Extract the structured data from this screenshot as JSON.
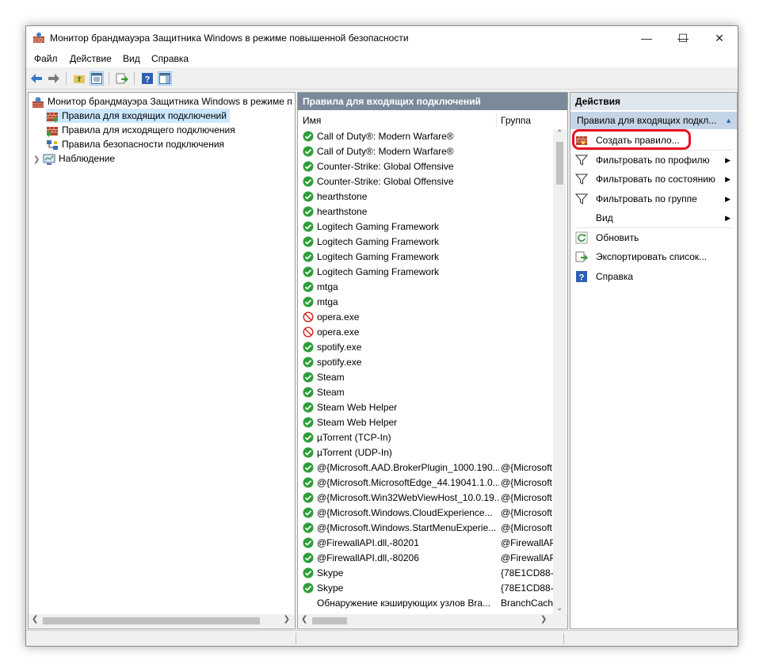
{
  "window": {
    "title": "Монитор брандмауэра Защитника Windows в режиме повышенной безопасности",
    "minimize": "—",
    "maximize": "☐",
    "close": "✕"
  },
  "menu": [
    "Файл",
    "Действие",
    "Вид",
    "Справка"
  ],
  "tree": {
    "root": "Монитор брандмауэра Защитника Windows в режиме п",
    "inbound": "Правила для входящих подключений",
    "outbound": "Правила для исходящего подключения",
    "security": "Правила безопасности подключения",
    "monitoring": "Наблюдение"
  },
  "middle": {
    "header": "Правила для входящих подключений",
    "col_name": "Имя",
    "col_group": "Группа",
    "rows": [
      {
        "name": "Call of Duty®: Modern Warfare®",
        "group": "",
        "status": "allow"
      },
      {
        "name": "Call of Duty®: Modern Warfare®",
        "group": "",
        "status": "allow"
      },
      {
        "name": "Counter-Strike: Global Offensive",
        "group": "",
        "status": "allow"
      },
      {
        "name": "Counter-Strike: Global Offensive",
        "group": "",
        "status": "allow"
      },
      {
        "name": "hearthstone",
        "group": "",
        "status": "allow"
      },
      {
        "name": "hearthstone",
        "group": "",
        "status": "allow"
      },
      {
        "name": "Logitech Gaming Framework",
        "group": "",
        "status": "allow"
      },
      {
        "name": "Logitech Gaming Framework",
        "group": "",
        "status": "allow"
      },
      {
        "name": "Logitech Gaming Framework",
        "group": "",
        "status": "allow"
      },
      {
        "name": "Logitech Gaming Framework",
        "group": "",
        "status": "allow"
      },
      {
        "name": "mtga",
        "group": "",
        "status": "allow"
      },
      {
        "name": "mtga",
        "group": "",
        "status": "allow"
      },
      {
        "name": "opera.exe",
        "group": "",
        "status": "block"
      },
      {
        "name": "opera.exe",
        "group": "",
        "status": "block"
      },
      {
        "name": "spotify.exe",
        "group": "",
        "status": "allow"
      },
      {
        "name": "spotify.exe",
        "group": "",
        "status": "allow"
      },
      {
        "name": "Steam",
        "group": "",
        "status": "allow"
      },
      {
        "name": "Steam",
        "group": "",
        "status": "allow"
      },
      {
        "name": "Steam Web Helper",
        "group": "",
        "status": "allow"
      },
      {
        "name": "Steam Web Helper",
        "group": "",
        "status": "allow"
      },
      {
        "name": "µTorrent (TCP-In)",
        "group": "",
        "status": "allow"
      },
      {
        "name": "µTorrent (UDP-In)",
        "group": "",
        "status": "allow"
      },
      {
        "name": "@{Microsoft.AAD.BrokerPlugin_1000.190...",
        "group": "@{Microsoft",
        "status": "allow"
      },
      {
        "name": "@{Microsoft.MicrosoftEdge_44.19041.1.0...",
        "group": "@{Microsoft",
        "status": "allow"
      },
      {
        "name": "@{Microsoft.Win32WebViewHost_10.0.19...",
        "group": "@{Microsoft",
        "status": "allow"
      },
      {
        "name": "@{Microsoft.Windows.CloudExperience...",
        "group": "@{Microsoft",
        "status": "allow"
      },
      {
        "name": "@{Microsoft.Windows.StartMenuExperie...",
        "group": "@{Microsoft",
        "status": "allow"
      },
      {
        "name": "@FirewallAPI.dll,-80201",
        "group": "@FirewallAP",
        "status": "allow"
      },
      {
        "name": "@FirewallAPI.dll,-80206",
        "group": "@FirewallAP",
        "status": "allow"
      },
      {
        "name": "Skype",
        "group": "{78E1CD88-4",
        "status": "allow"
      },
      {
        "name": "Skype",
        "group": "{78E1CD88-4",
        "status": "allow"
      },
      {
        "name": "Обнаружение кэширующих узлов Bra...",
        "group": "BranchCach",
        "status": "none"
      }
    ]
  },
  "actions": {
    "header": "Действия",
    "subheader": "Правила для входящих подкл...",
    "items": [
      {
        "label": "Создать правило...",
        "icon": "new-rule-icon",
        "submenu": false
      },
      {
        "label": "Фильтровать по профилю",
        "icon": "filter-icon",
        "submenu": true
      },
      {
        "label": "Фильтровать по состоянию",
        "icon": "filter-icon",
        "submenu": true
      },
      {
        "label": "Фильтровать по группе",
        "icon": "filter-icon",
        "submenu": true
      },
      {
        "label": "Вид",
        "icon": "",
        "submenu": true
      },
      {
        "label": "Обновить",
        "icon": "refresh-icon",
        "submenu": false
      },
      {
        "label": "Экспортировать список...",
        "icon": "export-icon",
        "submenu": false
      },
      {
        "label": "Справка",
        "icon": "help-icon",
        "submenu": false
      }
    ]
  },
  "colors": {
    "highlight": "#e81123",
    "selection": "#cce8ff",
    "allow": "#2e9e3a",
    "block": "#d41f1f"
  }
}
